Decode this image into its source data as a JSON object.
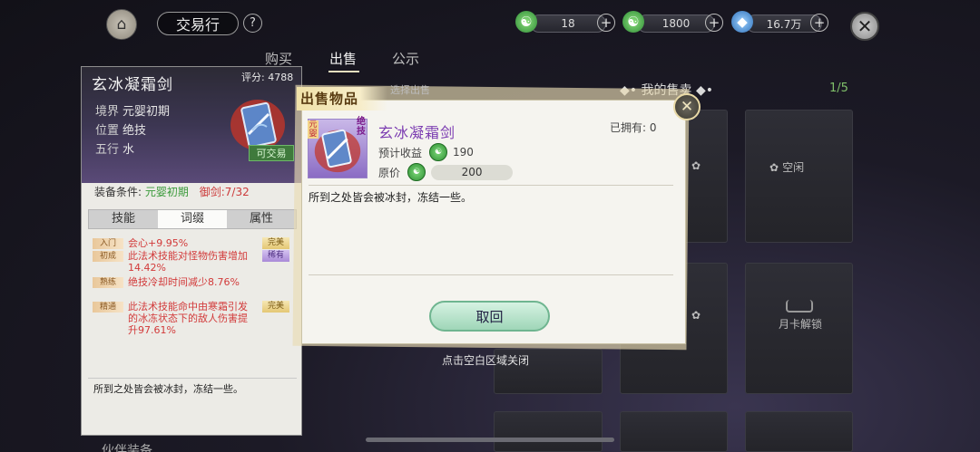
{
  "header": {
    "home_icon": "pavilion-icon",
    "title": "交易行",
    "help": "?",
    "currencies": [
      {
        "icon": "jade-coin-icon",
        "value": "18"
      },
      {
        "icon": "bound-coin-icon",
        "value": "1800"
      },
      {
        "icon": "spirit-stone-icon",
        "value": "16.7万"
      }
    ],
    "plus": "+",
    "close": "✕"
  },
  "tabs": {
    "buy": "购买",
    "sell": "出售",
    "public": "公示"
  },
  "sales": {
    "header": "我的售卖",
    "header_deco": "◆•",
    "count": "1/5",
    "idle_label": "空闲",
    "locked_label": "月卡解锁"
  },
  "item_panel": {
    "name": "玄冰凝霜剑",
    "score_label": "评分:",
    "score": "4788",
    "attrs": [
      {
        "key": "境界",
        "value": "元婴初期"
      },
      {
        "key": "位置",
        "value": "绝技"
      },
      {
        "key": "五行",
        "value": "水"
      }
    ],
    "tradable": "可交易",
    "req_label": "装备条件:",
    "req_realm": "元婴初期",
    "req_sword": "御剑:7/32",
    "tabs": [
      "技能",
      "词缀",
      "属性"
    ],
    "affixes": [
      {
        "level": "入门",
        "text": "会心+9.95%",
        "badge": "完美",
        "badge_type": "gold"
      },
      {
        "level": "初成",
        "text": "此法术技能对怪物伤害增加14.42%",
        "badge": "稀有",
        "badge_type": "purple"
      },
      {
        "level": "熟练",
        "text": "绝技冷却时间减少8.76%",
        "badge": "",
        "badge_type": ""
      },
      {
        "level": "精通",
        "text": "此法术技能命中由寒霜引发的冰冻状态下的敌人伤害提升97.61%",
        "badge": "完美",
        "badge_type": "gold"
      }
    ],
    "description": "所到之处皆会被冰封，冻结一些。"
  },
  "popup": {
    "ribbon": "出售物品",
    "select_hint": "选择出售",
    "realm_tag": "元婴",
    "type_tag": "绝技",
    "name": "玄冰凝霜剑",
    "owned_label": "已拥有:",
    "owned": "0",
    "income_label": "预计收益",
    "income": "190",
    "price_label": "原价",
    "price": "200",
    "description": "所到之处皆会被冰封，冻结一些。",
    "retrieve_button": "取回",
    "close": "✕"
  },
  "close_hint": "点击空白区域关闭",
  "partner_label": "伙伴装备"
}
